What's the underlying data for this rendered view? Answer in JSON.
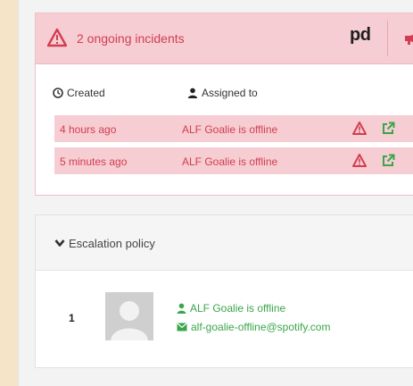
{
  "incidents": {
    "title": "2 ongoing incidents",
    "logo_text": "pd",
    "columns": {
      "created": "Created",
      "assigned_to": "Assigned to"
    },
    "rows": [
      {
        "created": "4 hours ago",
        "assigned_to": "ALF Goalie is offline"
      },
      {
        "created": "5 minutes ago",
        "assigned_to": "ALF Goalie is offline"
      }
    ]
  },
  "escalation": {
    "title": "Escalation policy",
    "steps": [
      {
        "number": "1",
        "user_name": "ALF Goalie is offline",
        "user_email": "alf-goalie-offline@spotify.com"
      }
    ]
  },
  "icons": {
    "header": [
      "warning-icon",
      "pagerduty-logo",
      "megaphone-icon"
    ],
    "columns": [
      "clock-icon",
      "user-icon"
    ],
    "row_actions": [
      "warning-icon",
      "external-link-icon"
    ],
    "escalation": [
      "chevron-down-icon",
      "avatar",
      "user-icon",
      "envelope-icon"
    ]
  },
  "colors": {
    "incident_red": "#d23d52",
    "incident_bg": "#f6cdd2",
    "link_green": "#3aa64a",
    "page_bg": "#f6e4c8"
  }
}
